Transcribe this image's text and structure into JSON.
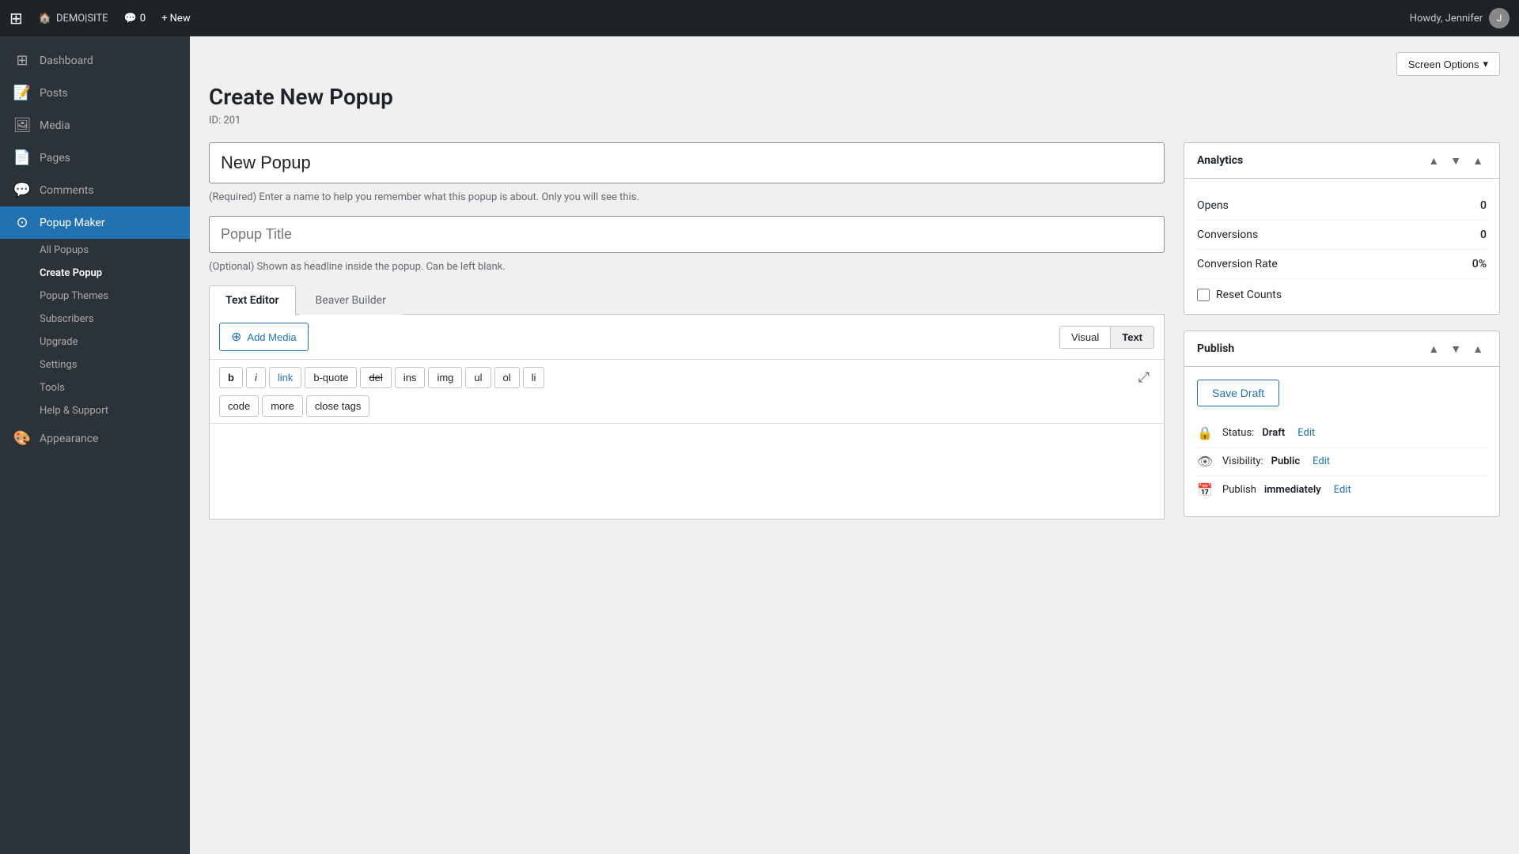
{
  "adminbar": {
    "logo": "⊞",
    "site_name": "DEMO|SITE",
    "home_icon": "🏠",
    "comments_icon": "💬",
    "comments_count": "0",
    "new_label": "+ New",
    "greeting": "Howdy, Jennifer"
  },
  "sidebar": {
    "items": [
      {
        "id": "dashboard",
        "label": "Dashboard",
        "icon": "⊞"
      },
      {
        "id": "posts",
        "label": "Posts",
        "icon": "📝"
      },
      {
        "id": "media",
        "label": "Media",
        "icon": "🖼"
      },
      {
        "id": "pages",
        "label": "Pages",
        "icon": "📄"
      },
      {
        "id": "comments",
        "label": "Comments",
        "icon": "💬"
      },
      {
        "id": "popup-maker",
        "label": "Popup Maker",
        "icon": "⊙",
        "active": true
      },
      {
        "id": "appearance",
        "label": "Appearance",
        "icon": "🎨"
      }
    ],
    "submenu": [
      {
        "id": "all-popups",
        "label": "All Popups"
      },
      {
        "id": "create-popup",
        "label": "Create Popup",
        "active": true
      },
      {
        "id": "popup-themes",
        "label": "Popup Themes"
      },
      {
        "id": "subscribers",
        "label": "Subscribers"
      },
      {
        "id": "upgrade",
        "label": "Upgrade"
      },
      {
        "id": "settings",
        "label": "Settings"
      },
      {
        "id": "tools",
        "label": "Tools"
      },
      {
        "id": "help-support",
        "label": "Help & Support"
      }
    ]
  },
  "page": {
    "title": "Create New Popup",
    "id_label": "ID: 201",
    "screen_options_label": "Screen Options"
  },
  "form": {
    "name_input_value": "New Popup",
    "name_hint": "(Required) Enter a name to help you remember what this popup is about. Only you will see this.",
    "title_placeholder": "Popup Title",
    "title_hint": "(Optional) Shown as headline inside the popup. Can be left blank."
  },
  "tabs": [
    {
      "id": "text-editor",
      "label": "Text Editor",
      "active": true
    },
    {
      "id": "beaver-builder",
      "label": "Beaver Builder"
    }
  ],
  "editor": {
    "add_media_label": "Add Media",
    "visual_label": "Visual",
    "text_label": "Text",
    "format_buttons": [
      "b",
      "i",
      "link",
      "b-quote",
      "del",
      "ins",
      "img",
      "ul",
      "ol",
      "li",
      "code",
      "more",
      "close tags"
    ],
    "expand_icon": "⤢"
  },
  "analytics": {
    "panel_title": "Analytics",
    "opens_label": "Opens",
    "opens_value": "0",
    "conversions_label": "Conversions",
    "conversions_value": "0",
    "conversion_rate_label": "Conversion Rate",
    "conversion_rate_value": "0%",
    "reset_counts_label": "Reset Counts"
  },
  "publish": {
    "panel_title": "Publish",
    "save_draft_label": "Save Draft",
    "status_label": "Status:",
    "status_value": "Draft",
    "status_edit": "Edit",
    "visibility_label": "Visibility:",
    "visibility_value": "Public",
    "visibility_edit": "Edit",
    "publish_label": "Publish",
    "publish_value": "immediately",
    "publish_edit": "Edit"
  }
}
